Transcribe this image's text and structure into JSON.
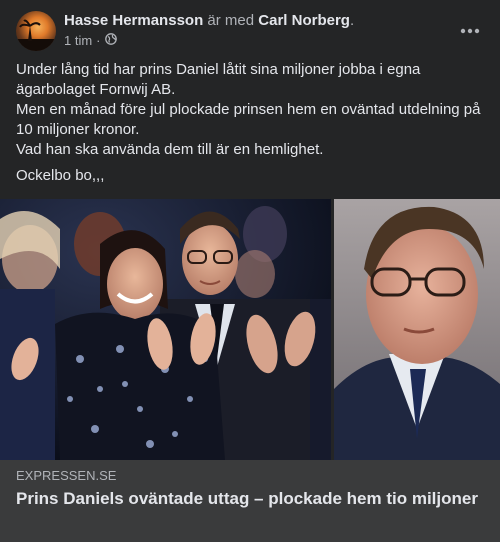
{
  "post": {
    "author": "Hasse Hermansson",
    "with_text": "är med",
    "tagged": "Carl Norberg",
    "period": ".",
    "time": "1 tim",
    "separator": "·",
    "privacy_icon": "globe-icon",
    "more_icon": "more-horizontal-icon",
    "text": {
      "line1": "Under lång tid har prins Daniel låtit sina miljoner jobba i egna ägarbolaget Fornwij AB.",
      "line2": "Men en månad före jul plockade prinsen hem en oväntad utdelning på 10 miljoner kronor.",
      "line3": "Vad han ska använda dem till är en hemlighet.",
      "line4": "Ockelbo bo,,,"
    }
  },
  "link": {
    "domain": "EXPRESSEN.SE",
    "headline": "Prins Daniels oväntade uttag – plockade hem tio miljoner"
  },
  "colors": {
    "background": "#242526",
    "link_box": "#3a3b3c",
    "primary_text": "#e4e6eb",
    "secondary_text": "#b0b3b8"
  }
}
